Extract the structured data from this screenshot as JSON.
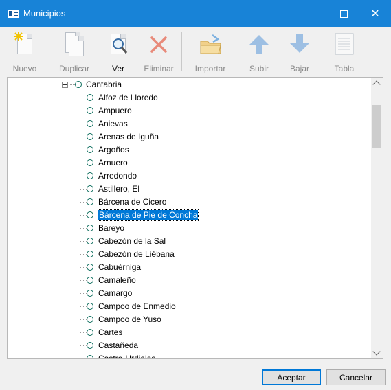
{
  "window": {
    "title": "Municipios"
  },
  "toolbar": {
    "nuevo": "Nuevo",
    "duplicar": "Duplicar",
    "ver": "Ver",
    "eliminar": "Eliminar",
    "importar": "Importar",
    "subir": "Subir",
    "bajar": "Bajar",
    "tabla": "Tabla"
  },
  "tree": {
    "parent": "Cantabria",
    "items": [
      "Alfoz de Lloredo",
      "Ampuero",
      "Anievas",
      "Arenas de Iguña",
      "Argoños",
      "Arnuero",
      "Arredondo",
      "Astillero, El",
      "Bárcena de Cicero",
      "Bárcena de Pie de Concha",
      "Bareyo",
      "Cabezón de la Sal",
      "Cabezón de Liébana",
      "Cabuérniga",
      "Camaleño",
      "Camargo",
      "Campoo de Enmedio",
      "Campoo de Yuso",
      "Cartes",
      "Castañeda",
      "Castro-Urdiales"
    ],
    "selected_index": 9
  },
  "buttons": {
    "accept": "Aceptar",
    "cancel": "Cancelar"
  },
  "colors": {
    "titlebar": "#1883d7",
    "selection": "#0078d7",
    "node": "#0f6f5f"
  }
}
